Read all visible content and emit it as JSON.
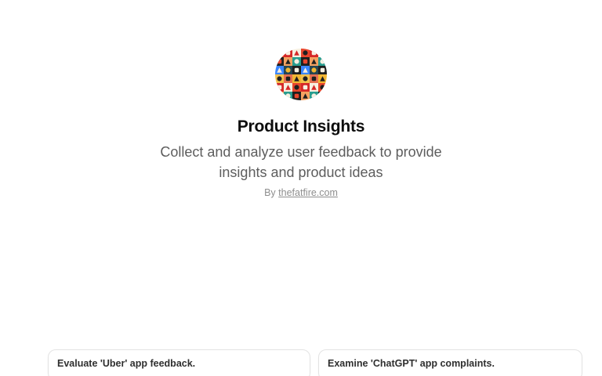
{
  "gpt": {
    "avatar_icon": "product-insights-icon-grid-avatar",
    "title": "Product Insights",
    "description": "Collect and analyze user feedback to provide insights and product ideas",
    "byline_prefix": "By",
    "author": "thefatfire.com"
  },
  "suggestions": [
    {
      "label": "Evaluate 'Uber' app feedback."
    },
    {
      "label": "Examine 'ChatGPT' app complaints."
    }
  ],
  "colors": {
    "title": "#0d0d0d",
    "description": "#5d5d5d",
    "byline": "#8e8e8e",
    "card_border": "#e3e3e3"
  }
}
